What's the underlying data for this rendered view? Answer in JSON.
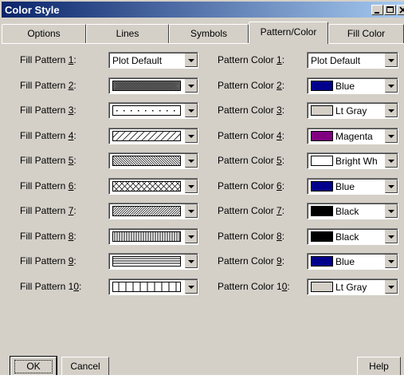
{
  "window": {
    "title": "Color Style"
  },
  "tabs": [
    {
      "label": "Options"
    },
    {
      "label": "Lines"
    },
    {
      "label": "Symbols"
    },
    {
      "label": "Pattern/Color",
      "active": true
    },
    {
      "label": "Fill Color"
    }
  ],
  "fill_patterns": [
    {
      "label_pre": "Fill Pattern ",
      "label_key": "1",
      "label_post": ":",
      "value": "Plot Default",
      "pattern": "plot-default"
    },
    {
      "label_pre": "Fill Pattern ",
      "label_key": "2",
      "label_post": ":",
      "value": "",
      "pattern": "crosshatch-dense"
    },
    {
      "label_pre": "Fill Pattern ",
      "label_key": "3",
      "label_post": ":",
      "value": "",
      "pattern": "dots"
    },
    {
      "label_pre": "Fill Pattern ",
      "label_key": "4",
      "label_post": ":",
      "value": "",
      "pattern": "diagonal-forward"
    },
    {
      "label_pre": "Fill Pattern ",
      "label_key": "5",
      "label_post": ":",
      "value": "",
      "pattern": "diagonal-back"
    },
    {
      "label_pre": "Fill Pattern ",
      "label_key": "6",
      "label_post": ":",
      "value": "",
      "pattern": "diagonal-cross"
    },
    {
      "label_pre": "Fill Pattern ",
      "label_key": "7",
      "label_post": ":",
      "value": "",
      "pattern": "diagonal-forward-dense"
    },
    {
      "label_pre": "Fill Pattern ",
      "label_key": "8",
      "label_post": ":",
      "value": "",
      "pattern": "vertical-dense"
    },
    {
      "label_pre": "Fill Pattern ",
      "label_key": "9",
      "label_post": ":",
      "value": "",
      "pattern": "horizontal"
    },
    {
      "label_pre": "Fill Pattern 1",
      "label_key": "0",
      "label_post": ":",
      "value": "",
      "pattern": "vertical"
    }
  ],
  "pattern_colors": [
    {
      "label_pre": "Pattern Color ",
      "label_key": "1",
      "label_post": ":",
      "value": "Plot Default",
      "swatch": ""
    },
    {
      "label_pre": "Pattern Color ",
      "label_key": "2",
      "label_post": ":",
      "value": "Blue",
      "swatch": "#00008b"
    },
    {
      "label_pre": "Pattern Color ",
      "label_key": "3",
      "label_post": ":",
      "value": "Lt Gray",
      "swatch": "#d4d0c8"
    },
    {
      "label_pre": "Pattern Color ",
      "label_key": "4",
      "label_post": ":",
      "value": "Magenta",
      "swatch": "#800080"
    },
    {
      "label_pre": "Pattern Color ",
      "label_key": "5",
      "label_post": ":",
      "value": "Bright Wh",
      "swatch": "#ffffff"
    },
    {
      "label_pre": "Pattern Color ",
      "label_key": "6",
      "label_post": ":",
      "value": "Blue",
      "swatch": "#00008b"
    },
    {
      "label_pre": "Pattern Color ",
      "label_key": "7",
      "label_post": ":",
      "value": "Black",
      "swatch": "#000000"
    },
    {
      "label_pre": "Pattern Color ",
      "label_key": "8",
      "label_post": ":",
      "value": "Black",
      "swatch": "#000000"
    },
    {
      "label_pre": "Pattern Color ",
      "label_key": "9",
      "label_post": ":",
      "value": "Blue",
      "swatch": "#00008b"
    },
    {
      "label_pre": "Pattern Color 1",
      "label_key": "0",
      "label_post": ":",
      "value": "Lt Gray",
      "swatch": "#d4d0c8"
    }
  ],
  "buttons": {
    "ok": "OK",
    "cancel": "Cancel",
    "help": "Help"
  }
}
